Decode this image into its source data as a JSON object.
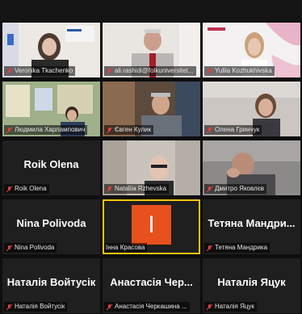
{
  "colors": {
    "background": "#0e0e0e",
    "tile": "#1f1f1f",
    "muted_mic": "#e04040",
    "avatar_orange": "#e8501e"
  },
  "participants": [
    {
      "label": "Veronika Tkachenko",
      "big": "",
      "mic": "muted-mic-icon"
    },
    {
      "label": "ali.rashidi@folkuniversitet...",
      "big": "",
      "mic": "muted-mic-icon"
    },
    {
      "label": "Yuliia Kozhukhivska",
      "big": "",
      "mic": "muted-mic-icon"
    },
    {
      "label": "Людмила Харлампович",
      "big": "",
      "mic": "muted-mic-icon"
    },
    {
      "label": "Євген Кулик",
      "big": "",
      "mic": "muted-mic-icon"
    },
    {
      "label": "Олена Гринчук",
      "big": "",
      "mic": "muted-mic-icon"
    },
    {
      "label": "Roik Olena",
      "big": "Roik Olena",
      "mic": "muted-mic-icon"
    },
    {
      "label": "Nataliia Rzhevska",
      "big": "",
      "mic": "muted-mic-icon"
    },
    {
      "label": "Дмитро Яковлєв",
      "big": "",
      "mic": "muted-mic-icon"
    },
    {
      "label": "Nina Polivoda",
      "big": "Nina Polivoda",
      "mic": "muted-mic-icon"
    },
    {
      "label": "Інна Красова",
      "big": "",
      "avatar_letter": "I",
      "mic": ""
    },
    {
      "label": "Тетяна Мандрика",
      "big": "Тетяна  Мандри...",
      "mic": "muted-mic-icon"
    },
    {
      "label": "Наталія Войтусік",
      "big": "Наталія Войтусік",
      "mic": "muted-mic-icon"
    },
    {
      "label": "Анастасія Черкашина ...",
      "big": "Анастасія   Чер...",
      "mic": "muted-mic-icon"
    },
    {
      "label": "Наталія Яцук",
      "big": "Наталія Яцук",
      "mic": "muted-mic-icon"
    }
  ]
}
